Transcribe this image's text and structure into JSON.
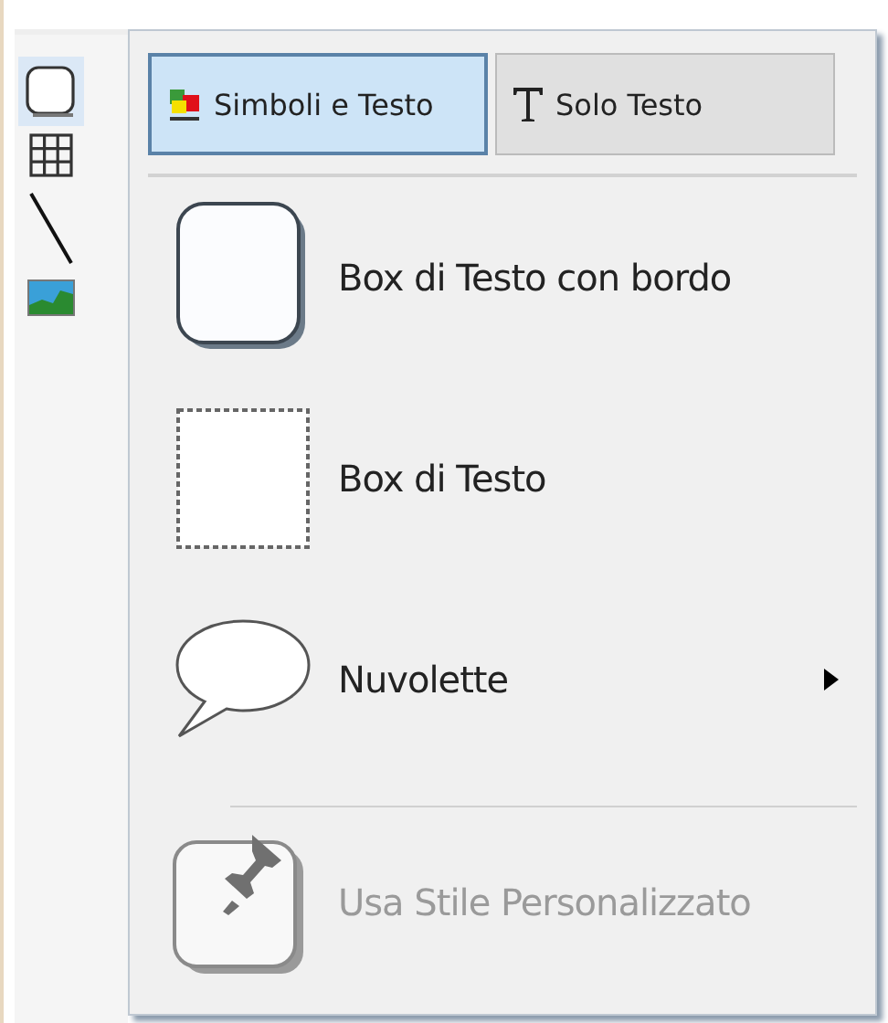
{
  "toolbar": [
    {
      "kind": "box",
      "selected": true
    },
    {
      "kind": "table",
      "selected": false
    },
    {
      "kind": "line",
      "selected": false
    },
    {
      "kind": "image",
      "selected": false
    }
  ],
  "tabs": [
    {
      "kind": "symbols",
      "label": "Simboli e Testo",
      "selected": true
    },
    {
      "kind": "text",
      "label": "Solo Testo",
      "selected": false
    }
  ],
  "items": [
    {
      "kind": "bordered-box",
      "label": "Box di Testo con bordo",
      "submenu": false,
      "disabled": false
    },
    {
      "kind": "dotted-box",
      "label": "Box di Testo",
      "submenu": false,
      "disabled": false
    },
    {
      "kind": "bubble",
      "label": "Nuvolette",
      "submenu": true,
      "disabled": false
    },
    {
      "kind": "separator"
    },
    {
      "kind": "custom-style",
      "label": "Usa Stile Personalizzato",
      "submenu": false,
      "disabled": true
    }
  ]
}
